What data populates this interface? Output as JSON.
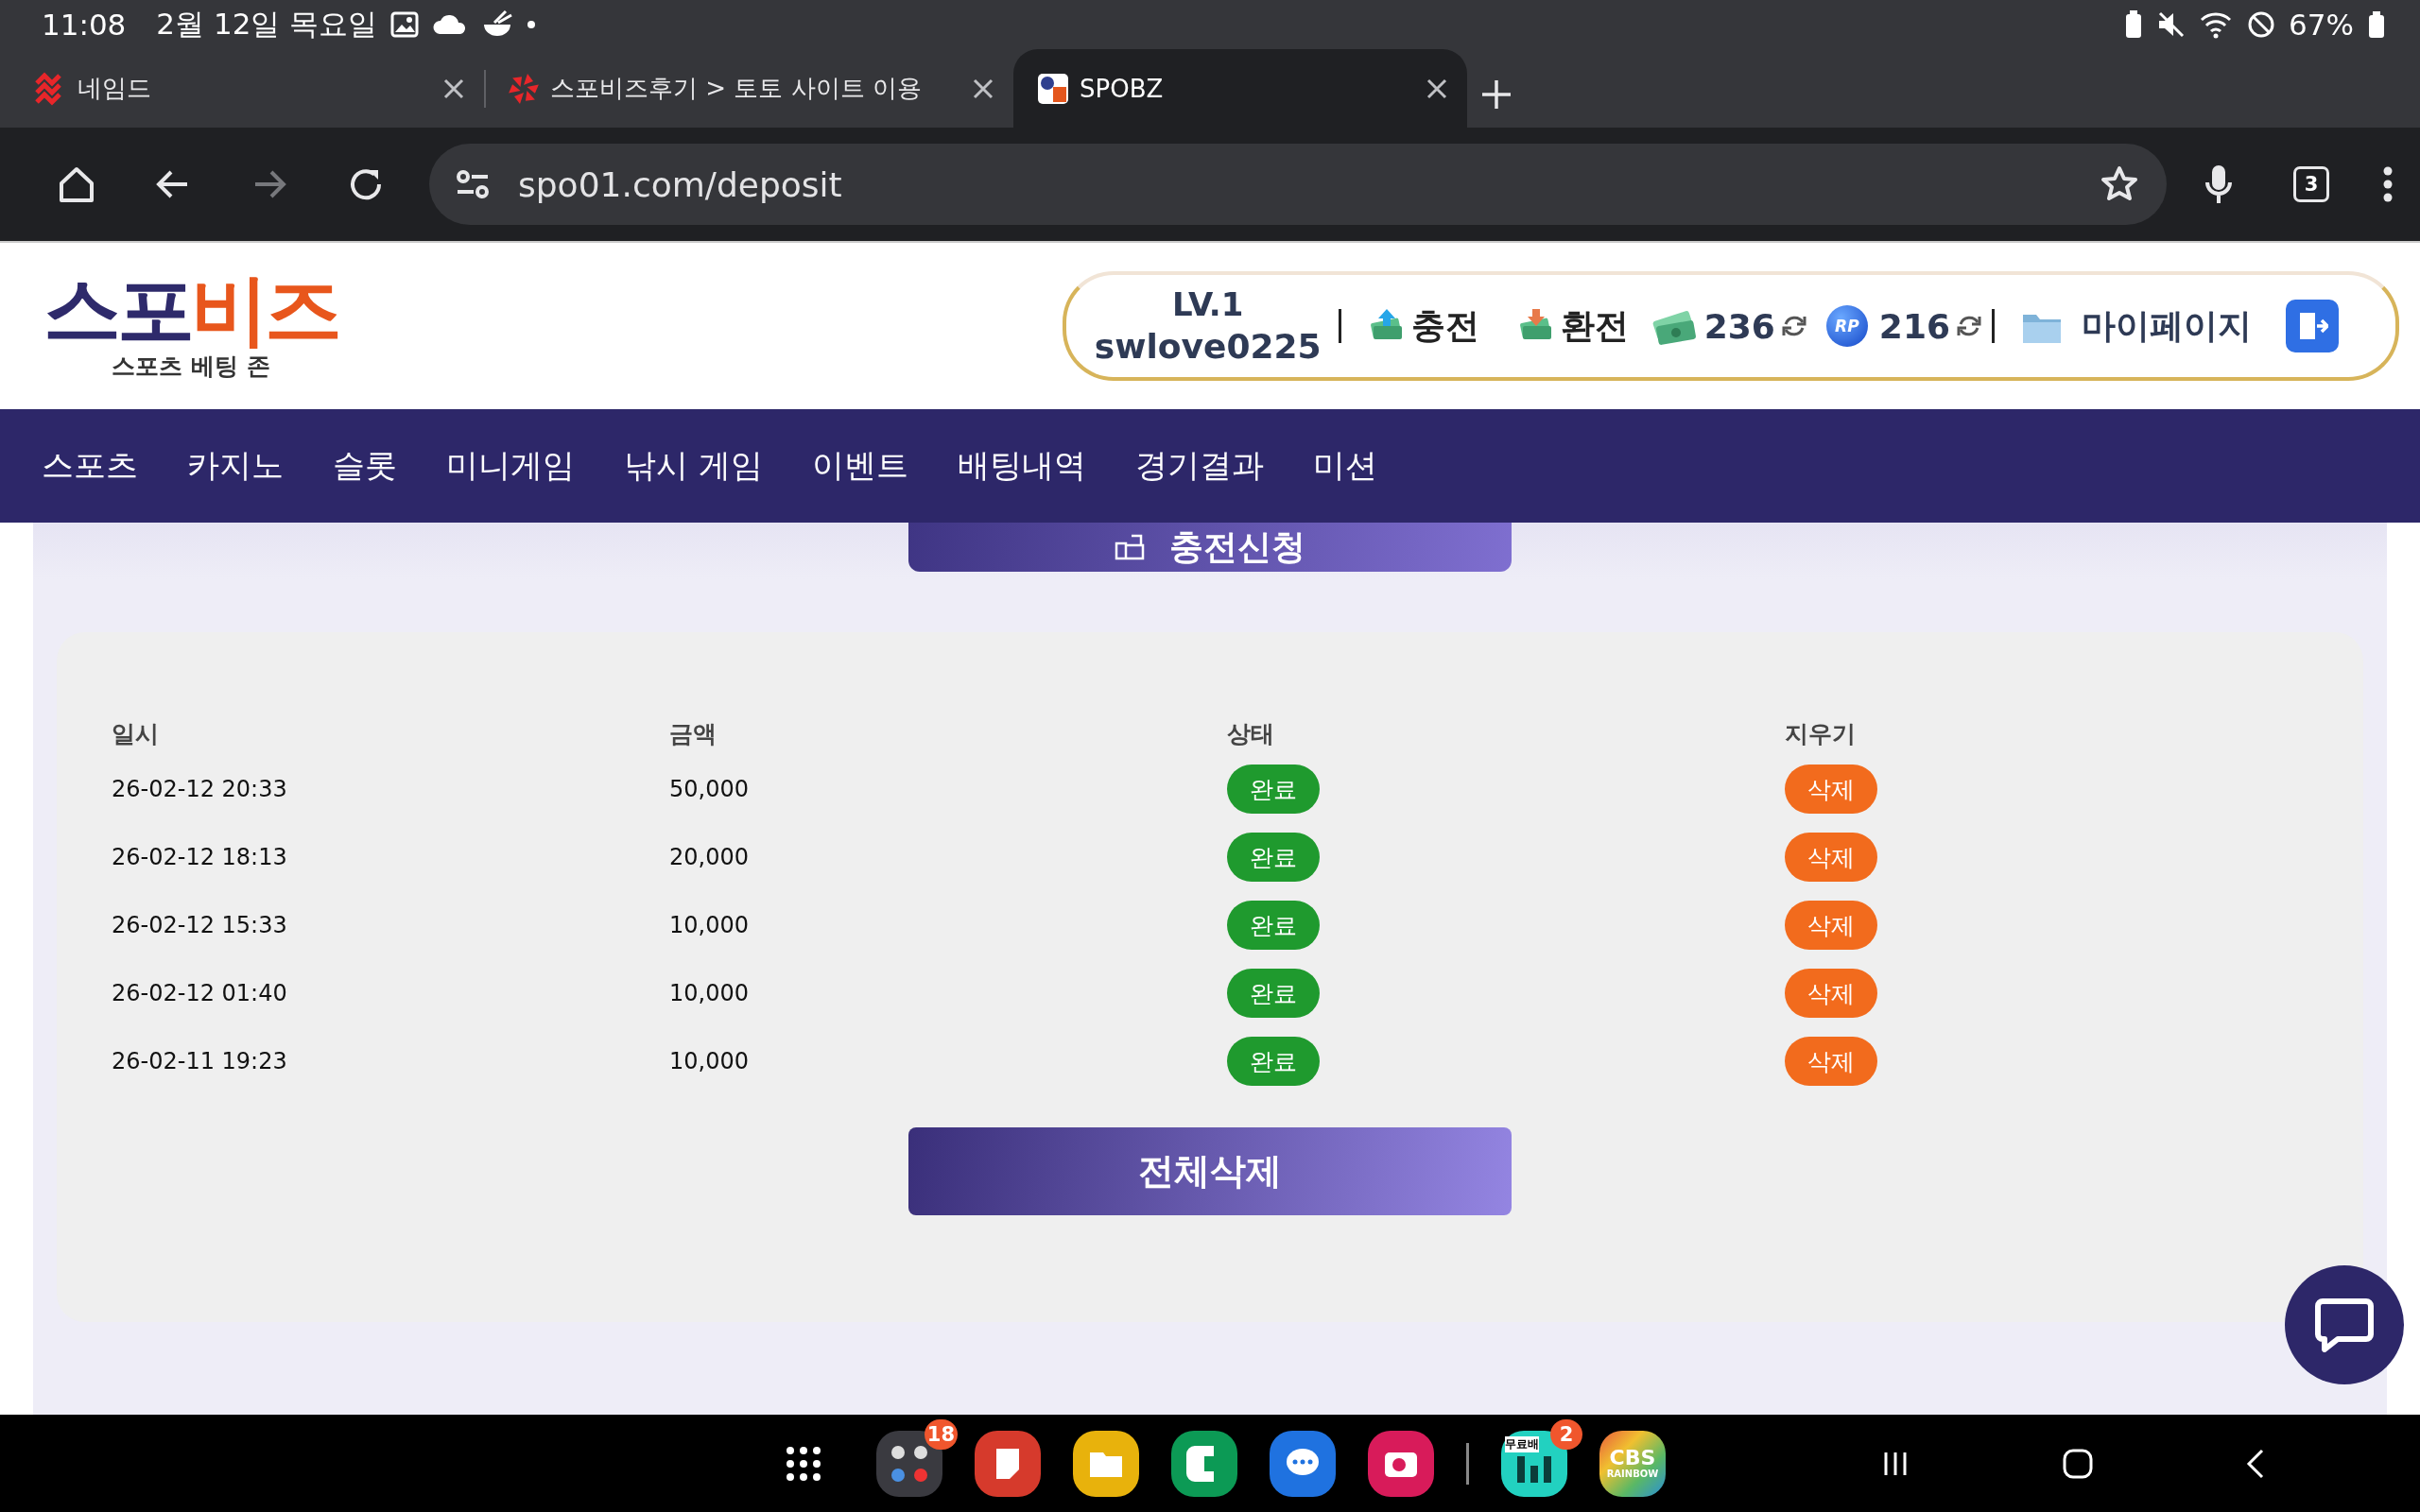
{
  "status_bar": {
    "time": "11:08",
    "date": "2월 12일 목요일",
    "battery": "67%"
  },
  "browser_tabs": [
    {
      "title": "네임드",
      "selected": false
    },
    {
      "title": "스포비즈후기 > 토토 사이트 이용",
      "selected": false
    },
    {
      "title": "SPOBZ",
      "selected": true
    }
  ],
  "toolbar": {
    "address": "spo01.com/deposit",
    "tab_count": "3"
  },
  "site_header": {
    "logo_part_1": "스포",
    "logo_part_2": "비즈",
    "tagline": "스포츠 베팅 존",
    "level": "LV.1",
    "username": "swlove0225",
    "charge": "충전",
    "exchange": "환전",
    "money": "236",
    "points_badge": "RP",
    "points": "216",
    "mypage": "마이페이지"
  },
  "nav": [
    "스포츠",
    "카지노",
    "슬롯",
    "미니게임",
    "낚시 게임",
    "이벤트",
    "배팅내역",
    "경기결과",
    "미션"
  ],
  "apply_button": "충전신청",
  "table": {
    "columns": [
      "일시",
      "금액",
      "상태",
      "지우기"
    ],
    "rows": [
      {
        "date": "26-02-12 20:33",
        "amount": "50,000",
        "status": "완료",
        "action": "삭제"
      },
      {
        "date": "26-02-12 18:13",
        "amount": "20,000",
        "status": "완료",
        "action": "삭제"
      },
      {
        "date": "26-02-12 15:33",
        "amount": "10,000",
        "status": "완료",
        "action": "삭제"
      },
      {
        "date": "26-02-12 01:40",
        "amount": "10,000",
        "status": "완료",
        "action": "삭제"
      },
      {
        "date": "26-02-11 19:23",
        "amount": "10,000",
        "status": "완료",
        "action": "삭제"
      }
    ]
  },
  "delete_all_button": "전체삭제",
  "dock": {
    "folder_badge": "18",
    "app_label": "무료배",
    "app_badge": "2",
    "cbs_logo": "CBS",
    "cbs_sub": "RAINBOW"
  }
}
